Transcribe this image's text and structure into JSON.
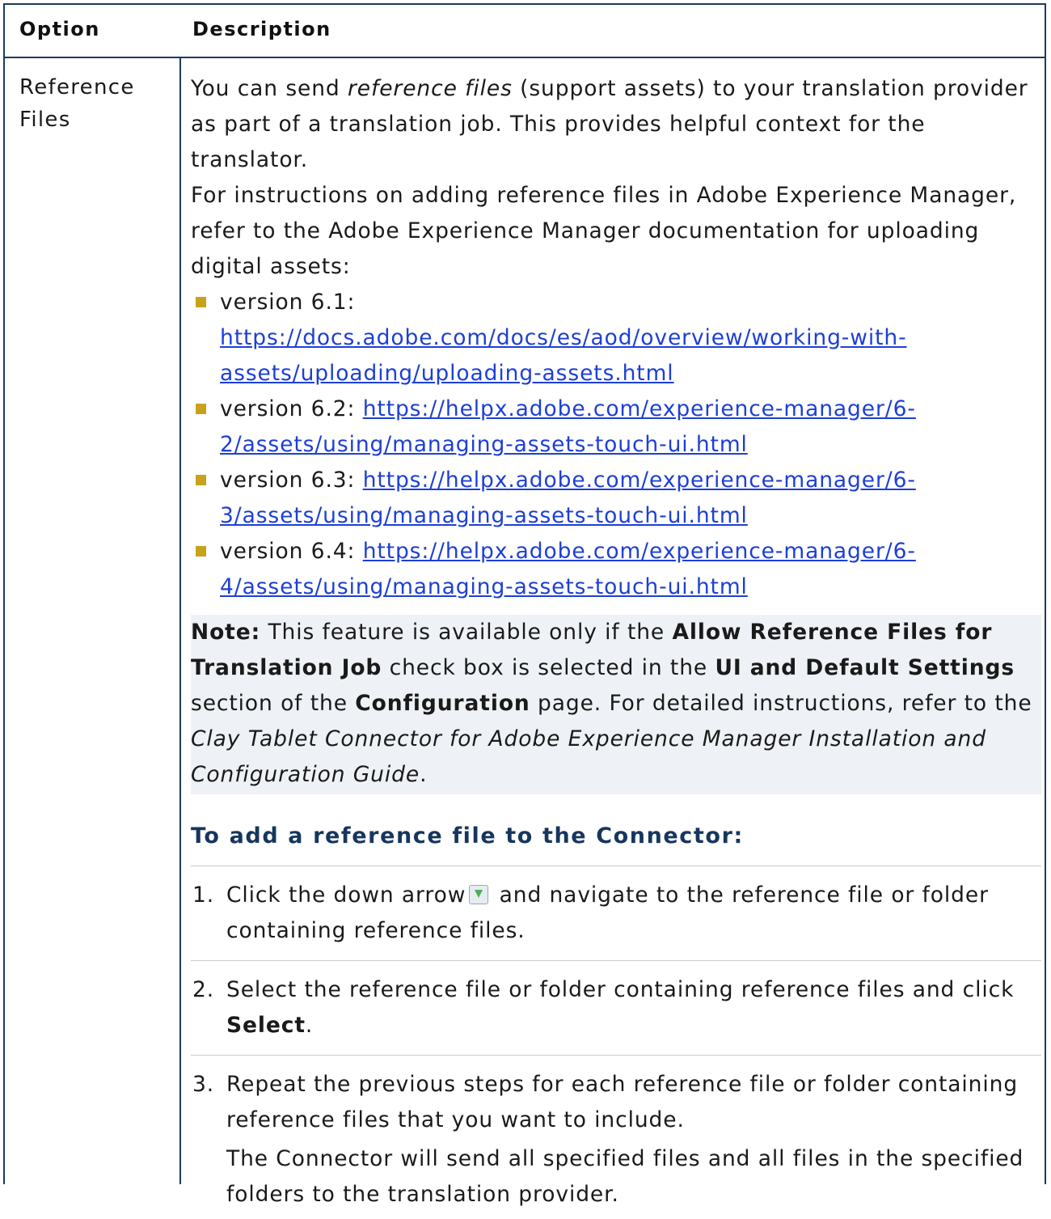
{
  "header": {
    "option": "Option",
    "description": "Description"
  },
  "row": {
    "option": "Reference Files",
    "intro_before": "You can send ",
    "intro_em": "reference files",
    "intro_after": " (support assets) to your translation provider as part of a translation job. This provides helpful context for the translator.",
    "instructions": "For instructions on adding reference files in Adobe Experience Manager, refer to the Adobe Experience Manager documentation for uploading digital assets:",
    "versions": [
      {
        "label": "version 6.1:",
        "url": "https://docs.adobe.com/docs/es/aod/overview/working-with-assets/uploading/uploading-assets.html"
      },
      {
        "label": "version 6.2:",
        "url": "https://helpx.adobe.com/experience-manager/6-2/assets/using/managing-assets-touch-ui.html"
      },
      {
        "label": "version 6.3:",
        "url": "https://helpx.adobe.com/experience-manager/6-3/assets/using/managing-assets-touch-ui.html"
      },
      {
        "label": "version 6.4:",
        "url": "https://helpx.adobe.com/experience-manager/6-4/assets/using/managing-assets-touch-ui.html"
      }
    ],
    "note": {
      "label": "Note:",
      "t1": " This feature is available only if the ",
      "b1": "Allow Reference Files for Translation Job",
      "t2": " check box is selected in the ",
      "b2": "UI and Default Settings",
      "t3": " section of the ",
      "b3": "Configuration",
      "t4": " page. For detailed instructions, refer to the ",
      "em": "Clay Tablet Connector for Adobe Experience Manager Installation and Configuration Guide",
      "t5": "."
    },
    "procedure_title": "To add a reference file to the Connector:",
    "steps": [
      {
        "num": "1.",
        "before": "Click the down arrow",
        "after": " and navigate to the reference file or folder containing reference files."
      },
      {
        "num": "2.",
        "before": "Select the reference file or folder containing reference files and click ",
        "bold": "Select",
        "after": "."
      },
      {
        "num": "3.",
        "before": "Repeat the previous steps for each reference file or folder containing reference files that you want to include.",
        "sub": "The Connector will send all specified files and all files in the specified folders to the translation provider."
      }
    ],
    "icon": "down-arrow-icon"
  }
}
